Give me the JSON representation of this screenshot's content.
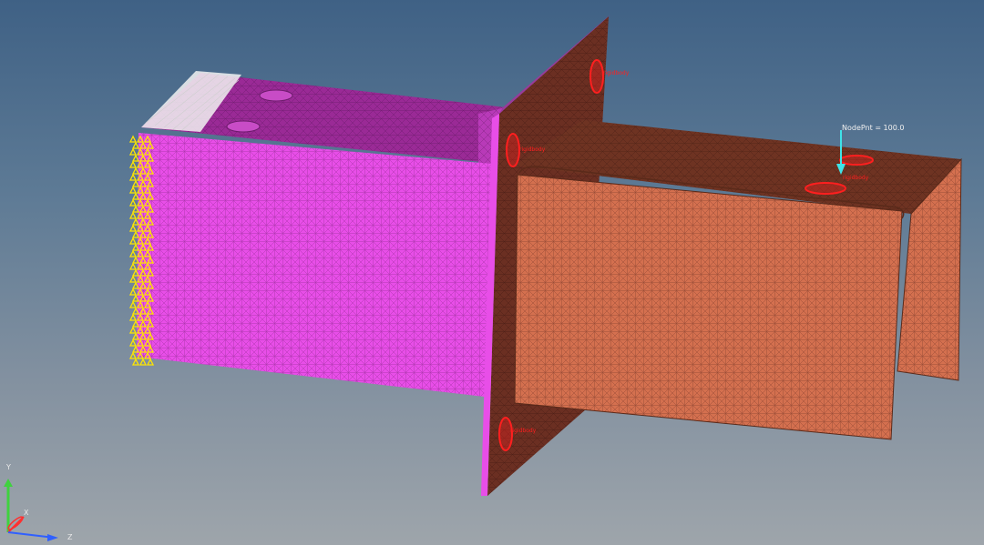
{
  "viewport": {
    "background_top": "#3f6185",
    "background_bottom": "#9ea5ab"
  },
  "model": {
    "components": [
      {
        "name": "box-section",
        "color": "#e84ee8"
      },
      {
        "name": "plate",
        "color": "#6b2f22"
      },
      {
        "name": "channel-section",
        "color": "#d4704f"
      }
    ],
    "load_label": "NodePnt = 100.0",
    "load_color": "#3fe3e8",
    "bolt_labels": [
      "rigidbody",
      "rigidbody",
      "rigidbody",
      "rigidbody"
    ],
    "bolt_color": "#ff1f1f",
    "constraint_color": "#ffe600"
  },
  "triad": {
    "x_label": "X",
    "y_label": "Y",
    "z_label": "Z",
    "x_color": "#ff3030",
    "y_color": "#3fd23f",
    "z_color": "#3060ff"
  }
}
